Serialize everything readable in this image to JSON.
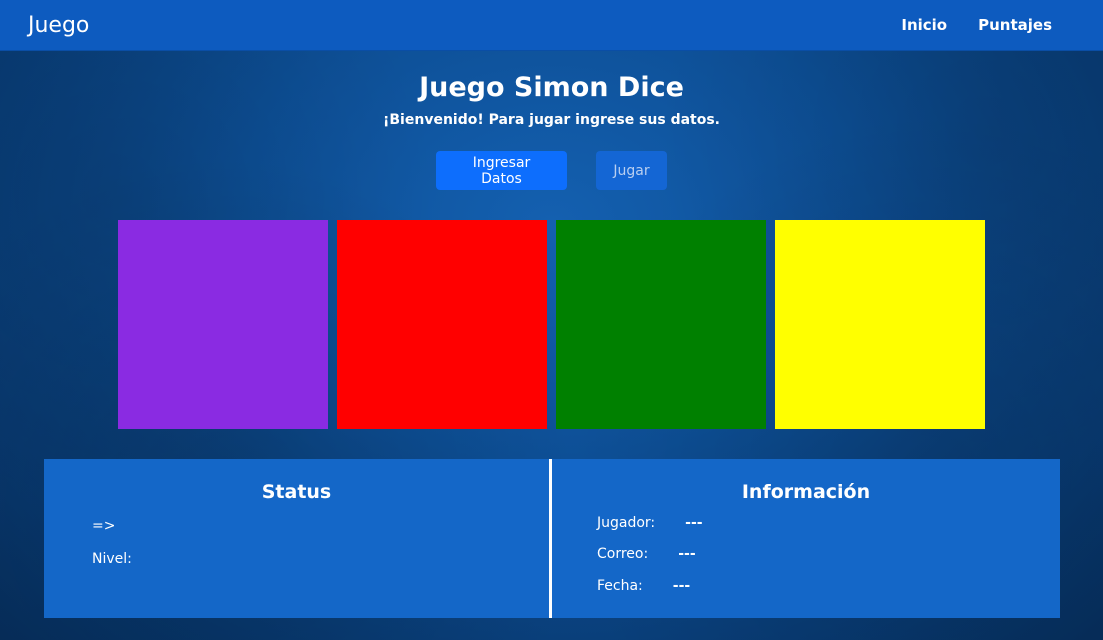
{
  "navbar": {
    "brand": "Juego",
    "links": [
      "Inicio",
      "Puntajes"
    ]
  },
  "header": {
    "title": "Juego Simon Dice",
    "subtitle": "¡Bienvenido! Para jugar ingrese sus datos."
  },
  "buttons": {
    "enter_data": "Ingresar Datos",
    "play": "Jugar"
  },
  "tiles": [
    {
      "color_name": "purple",
      "color": "#8a2be2"
    },
    {
      "color_name": "red",
      "color": "#ff0000"
    },
    {
      "color_name": "green",
      "color": "#008000"
    },
    {
      "color_name": "yellow",
      "color": "#ffff00"
    }
  ],
  "status": {
    "title": "Status",
    "arrow": "=>",
    "level_label": "Nivel:"
  },
  "info": {
    "title": "Información",
    "player_label": "Jugador:",
    "player_value": "---",
    "email_label": "Correo:",
    "email_value": "---",
    "date_label": "Fecha:",
    "date_value": "---"
  }
}
